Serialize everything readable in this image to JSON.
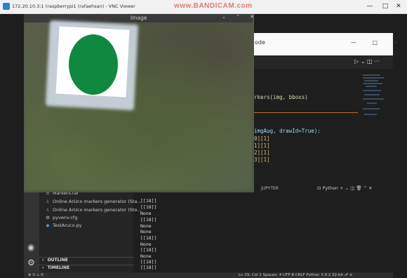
{
  "vnc": {
    "title": "172.20.10.3:1 (raspberrypi1 (rafaehsan) - VNC Viewer",
    "watermark": "www.BANDICAM.com",
    "minimize": "—",
    "maximize": "□",
    "close": "✕"
  },
  "image_window": {
    "title": "Image",
    "controls": "⌄ ⌃ ✕"
  },
  "vscode": {
    "title_fragment": "ode",
    "window_controls": "— □ ✕",
    "run_icons": "▷ ⌄  ◫  ···",
    "code_lines": [
      "rkers(img, bboxs)",
      "imgAug, drawId=True):",
      "0][1]",
      "1][1]",
      "2][1]",
      "3][1]"
    ],
    "panel_tab": "JUPYTER",
    "panel_controls": "⊡ Python  +  ⌄  ◫  🗑  ^  ✕"
  },
  "explorer": {
    "files": [
      {
        "icon": "≡",
        "name": "Markers.rar",
        "color": "#cccccc"
      },
      {
        "icon": "⅄",
        "name": "Online ArUco markers generator (Sta...",
        "color": "#e06c5a"
      },
      {
        "icon": "⅄",
        "name": "Online ArUco markers generator (Sto...",
        "color": "#e06c5a"
      },
      {
        "icon": "⚙",
        "name": "pyvenv.cfg",
        "color": "#cccccc"
      },
      {
        "icon": "◆",
        "name": "TestAruco.py",
        "color": "#4f9be8"
      }
    ],
    "outline": "OUTLINE",
    "timeline": "TIMELINE"
  },
  "terminal": {
    "lines": [
      "[[18]]",
      "[[18]]",
      "None",
      "[[18]]",
      "None",
      "None",
      "[[18]]",
      "None",
      "[[18]]",
      "None",
      "[[18]]",
      "[[18]]"
    ]
  },
  "statusbar": {
    "left": "⊗ 0  ⚠ 0",
    "right": "Ln 29, Col 1   Spaces: 4   UTF-8   CRLF   Python   3.9.2 32-bit   ☍   ⍾"
  }
}
